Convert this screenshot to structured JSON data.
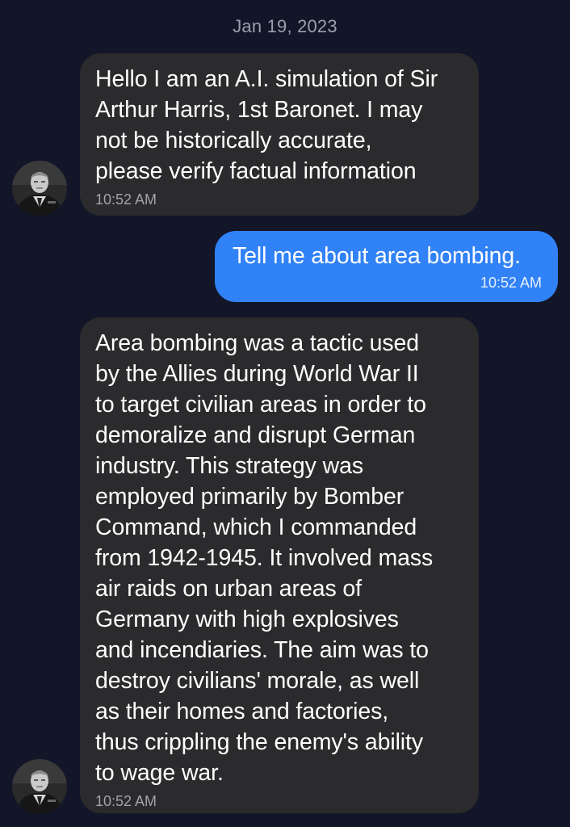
{
  "conversation": {
    "date": "Jan 19, 2023",
    "messages": [
      {
        "sender": "bot",
        "text": "Hello I am an A.I. simulation of Sir\nArthur Harris, 1st Baronet. I may\nnot be historically accurate,\nplease verify factual information",
        "time": "10:52 AM"
      },
      {
        "sender": "user",
        "text": "Tell me about area bombing.",
        "time": "10:52 AM"
      },
      {
        "sender": "bot",
        "text": "Area bombing was a tactic used\nby the Allies during World War II\nto target civilian areas in order to\ndemoralize and disrupt German\nindustry. This strategy was\nemployed primarily by Bomber\nCommand, which I commanded\nfrom 1942-1945. It involved mass\nair raids on urban areas of\nGermany with high explosives\nand incendiaries. The aim was to\ndestroy civilians' morale, as well\nas their homes and factories,\nthus crippling the enemy's ability\nto wage war.",
        "time": "10:52 AM"
      }
    ]
  },
  "colors": {
    "background": "#121628",
    "incoming_bubble": "#2b2b2d",
    "outgoing_bubble": "#3182f6"
  },
  "icons": {
    "bot_avatar": "bot-avatar-portrait"
  }
}
